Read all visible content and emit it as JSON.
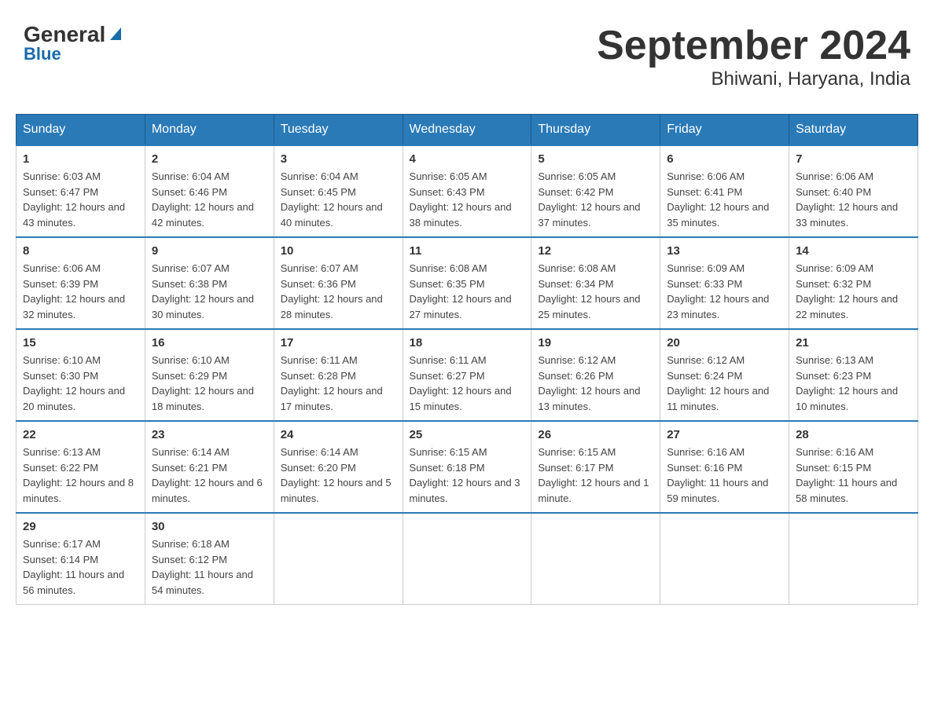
{
  "header": {
    "logo_general": "General",
    "logo_blue": "Blue",
    "title": "September 2024",
    "subtitle": "Bhiwani, Haryana, India"
  },
  "days_of_week": [
    "Sunday",
    "Monday",
    "Tuesday",
    "Wednesday",
    "Thursday",
    "Friday",
    "Saturday"
  ],
  "weeks": [
    [
      {
        "day": "1",
        "sunrise": "6:03 AM",
        "sunset": "6:47 PM",
        "daylight": "12 hours and 43 minutes."
      },
      {
        "day": "2",
        "sunrise": "6:04 AM",
        "sunset": "6:46 PM",
        "daylight": "12 hours and 42 minutes."
      },
      {
        "day": "3",
        "sunrise": "6:04 AM",
        "sunset": "6:45 PM",
        "daylight": "12 hours and 40 minutes."
      },
      {
        "day": "4",
        "sunrise": "6:05 AM",
        "sunset": "6:43 PM",
        "daylight": "12 hours and 38 minutes."
      },
      {
        "day": "5",
        "sunrise": "6:05 AM",
        "sunset": "6:42 PM",
        "daylight": "12 hours and 37 minutes."
      },
      {
        "day": "6",
        "sunrise": "6:06 AM",
        "sunset": "6:41 PM",
        "daylight": "12 hours and 35 minutes."
      },
      {
        "day": "7",
        "sunrise": "6:06 AM",
        "sunset": "6:40 PM",
        "daylight": "12 hours and 33 minutes."
      }
    ],
    [
      {
        "day": "8",
        "sunrise": "6:06 AM",
        "sunset": "6:39 PM",
        "daylight": "12 hours and 32 minutes."
      },
      {
        "day": "9",
        "sunrise": "6:07 AM",
        "sunset": "6:38 PM",
        "daylight": "12 hours and 30 minutes."
      },
      {
        "day": "10",
        "sunrise": "6:07 AM",
        "sunset": "6:36 PM",
        "daylight": "12 hours and 28 minutes."
      },
      {
        "day": "11",
        "sunrise": "6:08 AM",
        "sunset": "6:35 PM",
        "daylight": "12 hours and 27 minutes."
      },
      {
        "day": "12",
        "sunrise": "6:08 AM",
        "sunset": "6:34 PM",
        "daylight": "12 hours and 25 minutes."
      },
      {
        "day": "13",
        "sunrise": "6:09 AM",
        "sunset": "6:33 PM",
        "daylight": "12 hours and 23 minutes."
      },
      {
        "day": "14",
        "sunrise": "6:09 AM",
        "sunset": "6:32 PM",
        "daylight": "12 hours and 22 minutes."
      }
    ],
    [
      {
        "day": "15",
        "sunrise": "6:10 AM",
        "sunset": "6:30 PM",
        "daylight": "12 hours and 20 minutes."
      },
      {
        "day": "16",
        "sunrise": "6:10 AM",
        "sunset": "6:29 PM",
        "daylight": "12 hours and 18 minutes."
      },
      {
        "day": "17",
        "sunrise": "6:11 AM",
        "sunset": "6:28 PM",
        "daylight": "12 hours and 17 minutes."
      },
      {
        "day": "18",
        "sunrise": "6:11 AM",
        "sunset": "6:27 PM",
        "daylight": "12 hours and 15 minutes."
      },
      {
        "day": "19",
        "sunrise": "6:12 AM",
        "sunset": "6:26 PM",
        "daylight": "12 hours and 13 minutes."
      },
      {
        "day": "20",
        "sunrise": "6:12 AM",
        "sunset": "6:24 PM",
        "daylight": "12 hours and 11 minutes."
      },
      {
        "day": "21",
        "sunrise": "6:13 AM",
        "sunset": "6:23 PM",
        "daylight": "12 hours and 10 minutes."
      }
    ],
    [
      {
        "day": "22",
        "sunrise": "6:13 AM",
        "sunset": "6:22 PM",
        "daylight": "12 hours and 8 minutes."
      },
      {
        "day": "23",
        "sunrise": "6:14 AM",
        "sunset": "6:21 PM",
        "daylight": "12 hours and 6 minutes."
      },
      {
        "day": "24",
        "sunrise": "6:14 AM",
        "sunset": "6:20 PM",
        "daylight": "12 hours and 5 minutes."
      },
      {
        "day": "25",
        "sunrise": "6:15 AM",
        "sunset": "6:18 PM",
        "daylight": "12 hours and 3 minutes."
      },
      {
        "day": "26",
        "sunrise": "6:15 AM",
        "sunset": "6:17 PM",
        "daylight": "12 hours and 1 minute."
      },
      {
        "day": "27",
        "sunrise": "6:16 AM",
        "sunset": "6:16 PM",
        "daylight": "11 hours and 59 minutes."
      },
      {
        "day": "28",
        "sunrise": "6:16 AM",
        "sunset": "6:15 PM",
        "daylight": "11 hours and 58 minutes."
      }
    ],
    [
      {
        "day": "29",
        "sunrise": "6:17 AM",
        "sunset": "6:14 PM",
        "daylight": "11 hours and 56 minutes."
      },
      {
        "day": "30",
        "sunrise": "6:18 AM",
        "sunset": "6:12 PM",
        "daylight": "11 hours and 54 minutes."
      },
      null,
      null,
      null,
      null,
      null
    ]
  ],
  "labels": {
    "sunrise": "Sunrise:",
    "sunset": "Sunset:",
    "daylight": "Daylight:"
  }
}
